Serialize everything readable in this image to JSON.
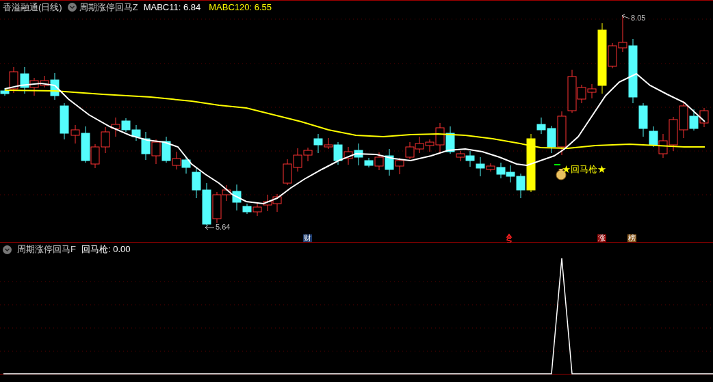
{
  "header": {
    "stock": "香溢融通",
    "period": "(日线)",
    "indicator": "周期涨停回马Z",
    "values": [
      {
        "label": "MABC11: 6.84",
        "color": "#ffffff"
      },
      {
        "label": "MABC120: 6.55",
        "color": "#ffff00"
      }
    ]
  },
  "main_chart": {
    "low_label": "5.64",
    "high_label": "8.05",
    "signal": "★回马枪★",
    "markers": [
      {
        "text": "财",
        "kind": "finance"
      },
      {
        "text": "涨",
        "kind": "limit"
      },
      {
        "text": "榜",
        "kind": "ranking"
      }
    ]
  },
  "sub_chart": {
    "indicator": "周期涨停回马F",
    "value": "回马枪: 0.00"
  }
}
